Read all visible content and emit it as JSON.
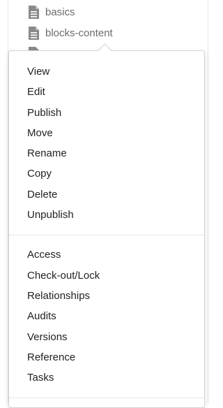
{
  "tree": {
    "items": [
      {
        "label": "basics",
        "icon": "file-icon"
      },
      {
        "label": "blocks-content",
        "icon": "file-icon"
      },
      {
        "label": "",
        "icon": "file-icon"
      }
    ]
  },
  "context_menu": {
    "group1": [
      "View",
      "Edit",
      "Publish",
      "Move",
      "Rename",
      "Copy",
      "Delete",
      "Unpublish"
    ],
    "group2": [
      "Access",
      "Check-out/Lock",
      "Relationships",
      "Audits",
      "Versions",
      "Reference",
      "Tasks"
    ]
  },
  "colors": {
    "icon_gray": "#8a8a8a",
    "tree_text": "#6b6b6b",
    "menu_text": "#222222",
    "border": "#d4d4d4"
  }
}
